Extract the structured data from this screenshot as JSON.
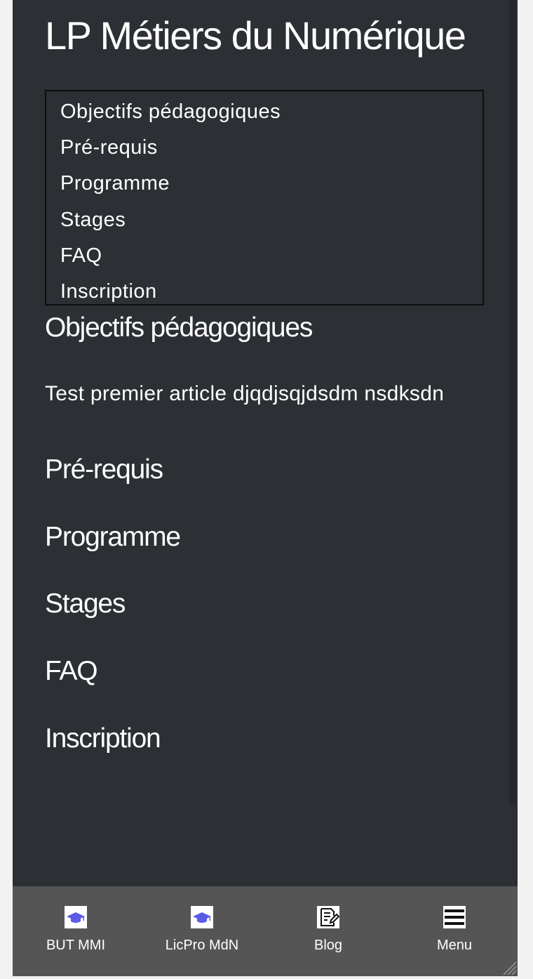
{
  "page": {
    "title": "LP Métiers du Numérique"
  },
  "toc": {
    "items": [
      {
        "label": "Objectifs pédagogiques"
      },
      {
        "label": "Pré-requis"
      },
      {
        "label": "Programme"
      },
      {
        "label": "Stages"
      },
      {
        "label": "FAQ"
      },
      {
        "label": "Inscription"
      }
    ]
  },
  "sections": [
    {
      "heading": "Objectifs pédagogiques",
      "text": "Test premier article djqdjsqjdsdm nsdksdn"
    },
    {
      "heading": "Pré-requis"
    },
    {
      "heading": "Programme"
    },
    {
      "heading": "Stages"
    },
    {
      "heading": "FAQ"
    },
    {
      "heading": "Inscription"
    }
  ],
  "bottom_nav": {
    "items": [
      {
        "label": "BUT MMI",
        "icon": "graduation-cap-icon"
      },
      {
        "label": "LicPro MdN",
        "icon": "graduation-cap-icon"
      },
      {
        "label": "Blog",
        "icon": "blog-edit-icon"
      },
      {
        "label": "Menu",
        "icon": "hamburger-menu-icon"
      }
    ]
  },
  "colors": {
    "background": "#2c2f33",
    "nav_background": "#555555",
    "text": "#ffffff",
    "cap_icon": "#5a5ae6"
  }
}
